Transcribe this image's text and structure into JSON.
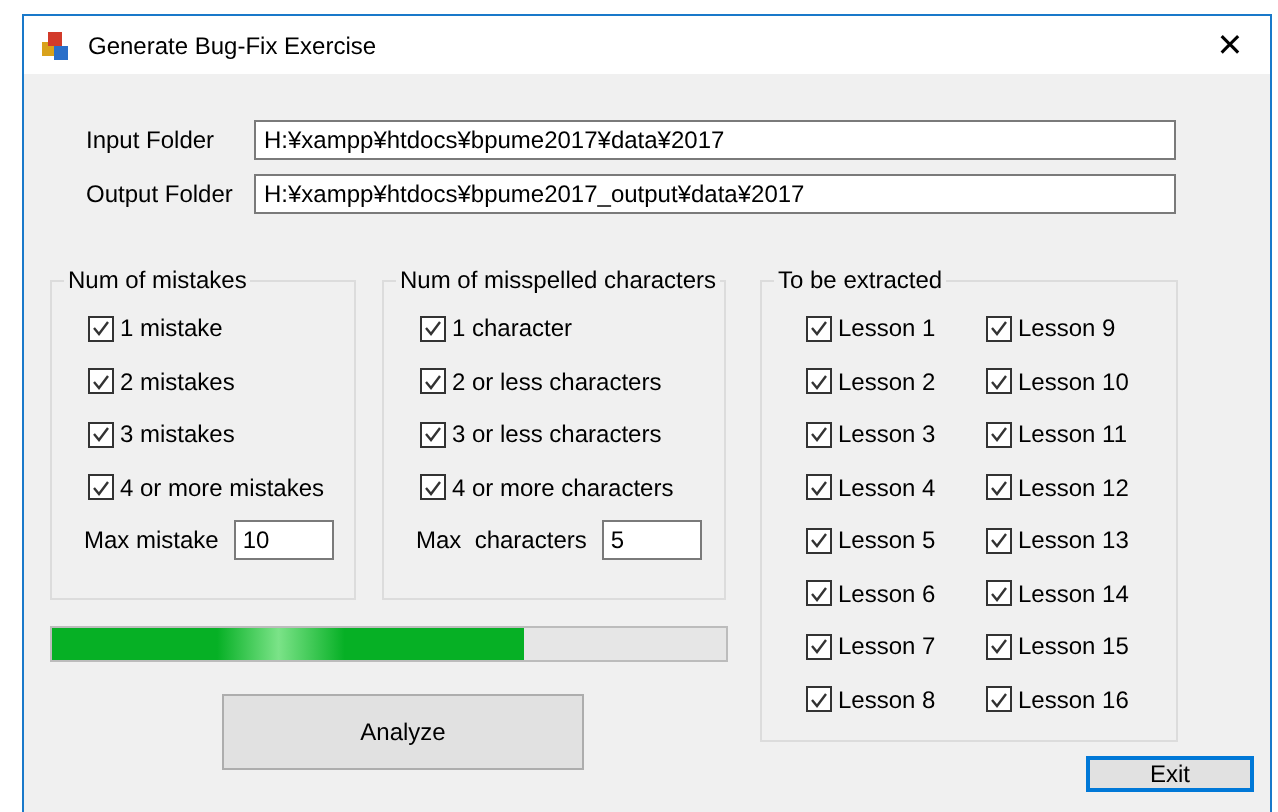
{
  "window": {
    "title": "Generate Bug-Fix Exercise",
    "close": "✕"
  },
  "folders": [
    {
      "label": "Input Folder",
      "value": "H:¥xampp¥htdocs¥bpume2017¥data¥2017"
    },
    {
      "label": "Output Folder",
      "value": "H:¥xampp¥htdocs¥bpume2017_output¥data¥2017"
    }
  ],
  "groups": [
    {
      "title": "Num of mistakes",
      "options": [
        {
          "label": "1 mistake",
          "checked": true
        },
        {
          "label": "2 mistakes",
          "checked": true
        },
        {
          "label": "3 mistakes",
          "checked": true
        },
        {
          "label": "4 or more mistakes",
          "checked": true
        }
      ],
      "max_label": "Max mistake",
      "max_value": "10"
    },
    {
      "title": "Num of misspelled characters",
      "options": [
        {
          "label": "1 character",
          "checked": true
        },
        {
          "label": "2 or less characters",
          "checked": true
        },
        {
          "label": "3 or less characters",
          "checked": true
        },
        {
          "label": "4 or more characters",
          "checked": true
        }
      ],
      "max_label": "Max  characters",
      "max_value": "5"
    }
  ],
  "progress": {
    "level": 0.7
  },
  "analyze_button": "Analyze",
  "extract": {
    "title": "To be extracted",
    "lessons": [
      {
        "label": "Lesson 1",
        "checked": true
      },
      {
        "label": "Lesson 2",
        "checked": true
      },
      {
        "label": "Lesson 3",
        "checked": true
      },
      {
        "label": "Lesson 4",
        "checked": true
      },
      {
        "label": "Lesson 5",
        "checked": true
      },
      {
        "label": "Lesson 6",
        "checked": true
      },
      {
        "label": "Lesson 7",
        "checked": true
      },
      {
        "label": "Lesson 8",
        "checked": true
      },
      {
        "label": "Lesson 9",
        "checked": true
      },
      {
        "label": "Lesson 10",
        "checked": true
      },
      {
        "label": "Lesson 11",
        "checked": true
      },
      {
        "label": "Lesson 12",
        "checked": true
      },
      {
        "label": "Lesson 13",
        "checked": true
      },
      {
        "label": "Lesson 14",
        "checked": true
      },
      {
        "label": "Lesson 15",
        "checked": true
      },
      {
        "label": "Lesson 16",
        "checked": true
      }
    ]
  },
  "exit_button": "Exit"
}
